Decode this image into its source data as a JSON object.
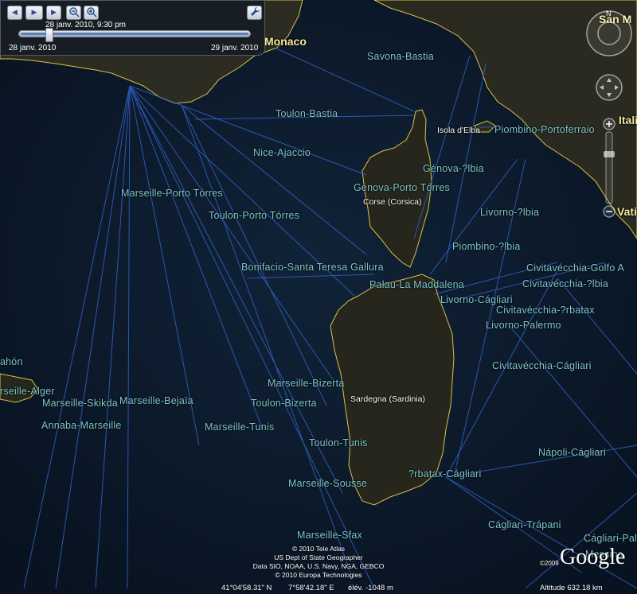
{
  "time_slider": {
    "current": "28 janv. 2010,   9:30 pm",
    "start": "28 janv. 2010",
    "end": "29 janv. 2010",
    "position_fraction": 0.12
  },
  "cities": {
    "monaco": "Monaco",
    "san_marino": "San M",
    "italia": "Itali",
    "vatican": "Vati"
  },
  "places": {
    "elba": "Isola d'Elba",
    "corsica": "Corse (Corsica)",
    "sardinia": "Sardegna (Sardinia)"
  },
  "routes": [
    "Savona-Bastia",
    "Toulon-Bastia",
    "Piombino-Portoferraio",
    "Nice-Ajaccio",
    "Génova-?lbia",
    "Marseille-Porto Tórres",
    "Génova-Porto Tórres",
    "Toulon-Porto Tórres",
    "Livorno-?lbia",
    "Piombino-?lbia",
    "Bonifacio-Santa Teresa Gallura",
    "Civitavécchia-Golfo A",
    "Palau-La Maddalena",
    "Civitavécchia-?lbia",
    "Livorno-Cágliari",
    "Civitavécchia-?rbatax",
    "Livorno-Palermo",
    "ahón",
    "Civitavécchia-Cágliari",
    "Marseille-Bizerta",
    "rseille-Alger",
    "Marseille-Bejaïa",
    "Marseille-Skikda",
    "Toulon-Bizerta",
    "Annaba-Marseille",
    "Marseille-Tunis",
    "Toulon-Tunis",
    "Nápoli-Cágliari",
    "?rbatax-Cágliari",
    "Marseille-Sousse",
    "Cágliari-Trápani",
    "Marseille-Sfax",
    "Cágliari-Palerm",
    "Messina"
  ],
  "attribution": {
    "line1": "© 2010 Tele Atlas",
    "line2": "US Dept of State Geographer",
    "line3": "Data SIO, NOAA, U.S. Navy, NGA, GEBCO",
    "line4": "© 2010 Europa Technologies",
    "copyright_year": "©2009",
    "logo": "Google"
  },
  "status": {
    "lat": "41°04'58.31\" N",
    "lon": "7°58'42.18\" E",
    "elev": "élév.  -1048 m",
    "altitude": "Altitude   632.18 km"
  },
  "colors": {
    "sea": "#0b1728",
    "land": "#2b2b20",
    "route_line": "#2f62c8",
    "route_label": "#7fc8cc",
    "coast": "#e6d040"
  },
  "icons": {
    "settings": "wrench-icon"
  }
}
